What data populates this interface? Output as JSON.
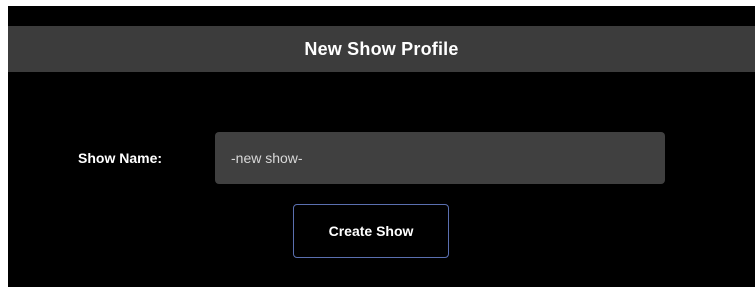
{
  "dialog": {
    "title": "New Show Profile"
  },
  "form": {
    "show_name_label": "Show Name:",
    "show_name_value": "-new show-",
    "create_button_label": "Create Show"
  }
}
